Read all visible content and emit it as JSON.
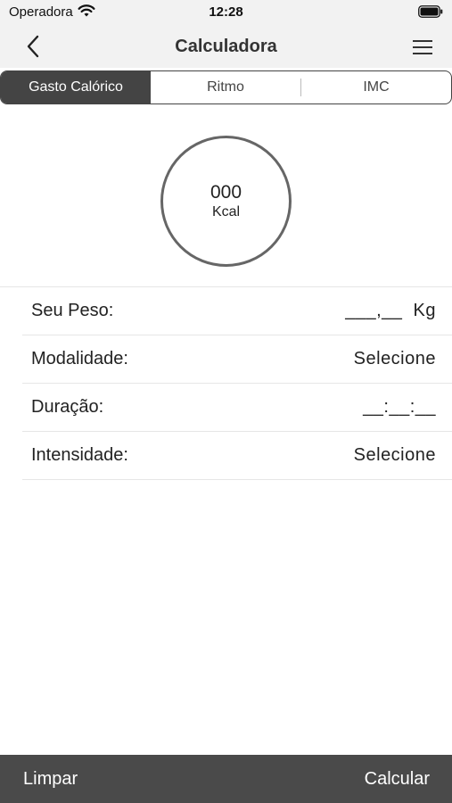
{
  "status": {
    "carrier": "Operadora",
    "time": "12:28",
    "wifi_icon": "wifi-icon",
    "battery_icon": "battery-icon"
  },
  "nav": {
    "title": "Calculadora",
    "back_icon": "chevron-left-icon",
    "menu_icon": "hamburger-menu-icon"
  },
  "tabs": [
    {
      "label": "Gasto Calórico",
      "active": true
    },
    {
      "label": "Ritmo",
      "active": false
    },
    {
      "label": "IMC",
      "active": false
    }
  ],
  "result": {
    "value": "000",
    "unit": "Kcal"
  },
  "form": {
    "rows": [
      {
        "label": "Seu Peso:",
        "value": "___,__  Kg"
      },
      {
        "label": "Modalidade:",
        "value": "Selecione"
      },
      {
        "label": "Duração:",
        "value": "__:__:__"
      },
      {
        "label": "Intensidade:",
        "value": "Selecione"
      }
    ]
  },
  "bottom": {
    "clear_label": "Limpar",
    "calculate_label": "Calcular"
  },
  "colors": {
    "accent": "#444444",
    "bottom_bar": "#4a4a4a",
    "nav_bg": "#f2f2f2"
  }
}
